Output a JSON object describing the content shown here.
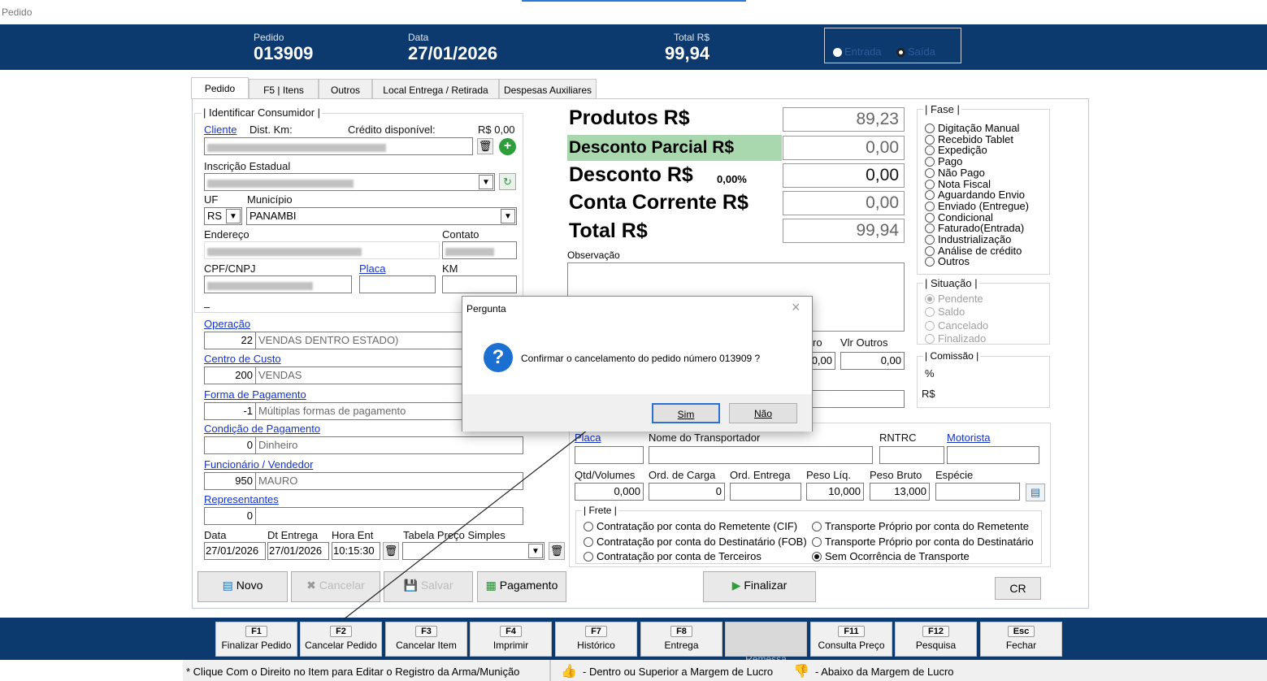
{
  "window": {
    "title": "Pedido"
  },
  "header": {
    "pedido_label": "Pedido",
    "pedido_value": "013909",
    "data_label": "Data",
    "data_value": "27/01/2026",
    "total_label": "Total R$",
    "total_value": "99,94",
    "tipo_entrada": "Entrada",
    "tipo_saida": "Saída"
  },
  "tabs": [
    "Pedido",
    "F5 | Itens",
    "Outros",
    "Local Entrega / Retirada",
    "Despesas Auxiliares"
  ],
  "consumidor": {
    "group_title": "| Identificar Consumidor |",
    "cliente_label": "Cliente",
    "dist_label": "Dist. Km:",
    "credito_label": "Crédito disponível:",
    "credito_value": "R$ 0,00",
    "inscricao_label": "Inscrição Estadual",
    "uf_label": "UF",
    "uf_value": "RS",
    "municipio_label": "Município",
    "municipio_value": "PANAMBI",
    "endereco_label": "Endereço",
    "contato_label": "Contato",
    "cpf_label": "CPF/CNPJ",
    "placa_label": "Placa",
    "km_label": "KM",
    "dash": "–"
  },
  "fields": {
    "operacao_label": "Operação",
    "operacao_code": "22",
    "operacao_desc": "VENDAS DENTRO ESTADO)",
    "centro_label": "Centro de Custo",
    "centro_code": "200",
    "centro_desc": "VENDAS",
    "forma_label": "Forma de Pagamento",
    "forma_code": "-1",
    "forma_desc": "Múltiplas formas de pagamento",
    "condicao_label": "Condição de Pagamento",
    "condicao_code": "0",
    "condicao_desc": "Dinheiro",
    "funcionario_label": "Funcionário / Vendedor",
    "funcionario_code": "950",
    "funcionario_desc": "MAURO",
    "representantes_label": "Representantes",
    "representantes_code": "0",
    "data_label": "Data",
    "data_value": "27/01/2026",
    "dtentrega_label": "Dt Entrega",
    "dtentrega_value": "27/01/2026",
    "horaent_label": "Hora Ent",
    "horaent_value": "10:15:30",
    "tabela_label": "Tabela Preço Simples"
  },
  "totais": {
    "produtos_label": "Produtos R$",
    "produtos_value": "89,23",
    "desconto_parcial_label": "Desconto Parcial R$",
    "desconto_parcial_value": "0,00",
    "desconto_label": "Desconto R$",
    "desconto_pct": "0,00%",
    "desconto_value": "0,00",
    "conta_label": "Conta Corrente R$",
    "conta_value": "0,00",
    "total_label": "Total R$",
    "total_value": "99,94",
    "observacao_label": "Observação"
  },
  "fase": {
    "title": "| Fase |",
    "options": [
      "Digitação Manual",
      "Recebido Tablet",
      "Expedição",
      "Pago",
      "Não Pago",
      "Nota Fiscal",
      "Aguardando Envio",
      "Enviado (Entregue)",
      "Condicional",
      "Faturado(Entrada)",
      "Industrialização",
      "Análise de crédito",
      "Outros"
    ]
  },
  "situacao": {
    "title": "| Situação |",
    "options": [
      "Pendente",
      "Saldo",
      "Cancelado",
      "Finalizado"
    ]
  },
  "comissao": {
    "title": "| Comissão |",
    "pct": "%",
    "rs": "R$"
  },
  "outros_vals": {
    "seguro_label": "ro",
    "seguro_value": "0,00",
    "vlr_outros_label": "Vlr Outros",
    "vlr_outros_value": "0,00"
  },
  "transporte": {
    "placa_label": "Placa",
    "nome_label": "Nome do Transportador",
    "rntrc_label": "RNTRC",
    "motorista_label": "Motorista",
    "qtd_label": "Qtd/Volumes",
    "qtd_value": "0,000",
    "ordcarga_label": "Ord. de Carga",
    "ordcarga_value": "0",
    "ordentrega_label": "Ord. Entrega",
    "pesoliq_label": "Peso Líq.",
    "pesoliq_value": "10,000",
    "pesobruto_label": "Peso Bruto",
    "pesobruto_value": "13,000",
    "especie_label": "Espécie",
    "frete_title": "| Frete |",
    "frete_opts": [
      "Contratação por conta do Remetente (CIF)",
      "Contratação por conta do Destinatário (FOB)",
      "Contratação por conta de Terceiros",
      "Transporte Próprio por conta do Remetente",
      "Transporte Próprio por conta do Destinatário",
      "Sem Ocorrência de Transporte"
    ]
  },
  "buttons": {
    "novo": "Novo",
    "cancelar": "Cancelar",
    "salvar": "Salvar",
    "pagamento": "Pagamento",
    "finalizar": "Finalizar",
    "cr": "CR"
  },
  "fkeys": [
    {
      "k": "F1",
      "n": "Finalizar Pedido"
    },
    {
      "k": "F2",
      "n": "Cancelar Pedido"
    },
    {
      "k": "F3",
      "n": "Cancelar Item"
    },
    {
      "k": "F4",
      "n": "Imprimir"
    },
    {
      "k": "F7",
      "n": "Histórico"
    },
    {
      "k": "F8",
      "n": "Entrega"
    },
    {
      "k": "",
      "n": "Remessa"
    },
    {
      "k": "F11",
      "n": "Consulta Preço"
    },
    {
      "k": "F12",
      "n": "Pesquisa"
    },
    {
      "k": "Esc",
      "n": "Fechar"
    }
  ],
  "status": {
    "hint": "* Clique Com o Direito no Item para Editar o Registro da Arma/Munição",
    "up": "- Dentro ou Superior a Margem de Lucro",
    "down": "- Abaixo da Margem de Lucro"
  },
  "dialog": {
    "title": "Pergunta",
    "message": "Confirmar o cancelamento do pedido número 013909 ?",
    "sim": "Sim",
    "nao": "Não"
  }
}
